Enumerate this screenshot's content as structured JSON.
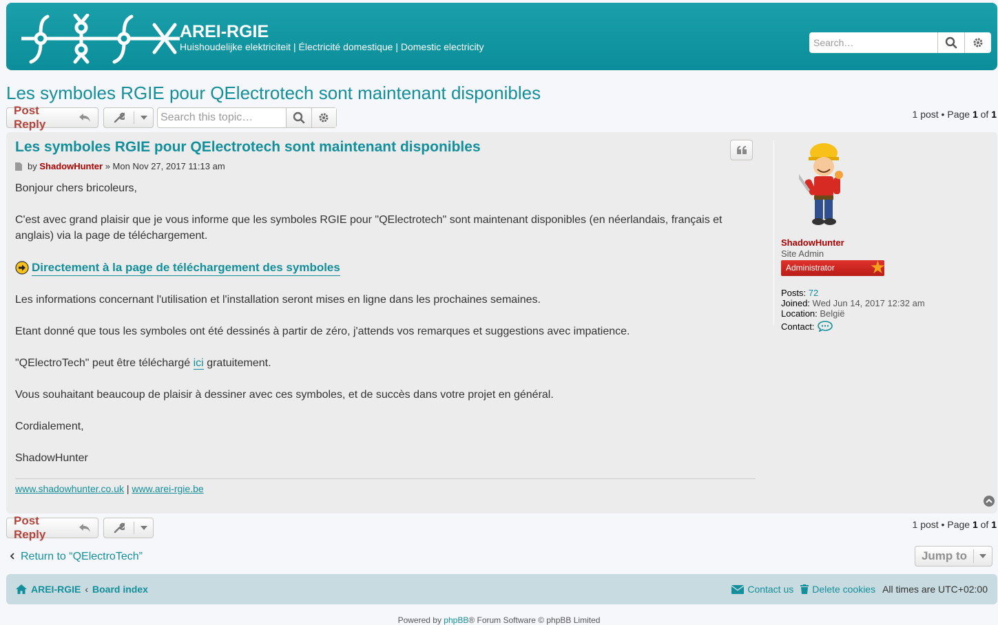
{
  "header": {
    "site_title": "AREI-RGIE",
    "site_desc": "Huishoudelijke elektriciteit | Électricité domestique | Domestic electricity",
    "search_placeholder": "Search…",
    "logo_icon": "circuit-logo-icon"
  },
  "topic": {
    "title": "Les symboles RGIE pour QElectrotech sont maintenant disponibles",
    "post_reply": "Post Reply",
    "search_placeholder": "Search this topic…",
    "pagination_prefix": "1 post • Page",
    "page_current": "1",
    "page_of": "of",
    "page_total": "1"
  },
  "post": {
    "title": "Les symboles RGIE pour QElectrotech sont maintenant disponibles",
    "by": "by",
    "author": "ShadowHunter",
    "date": "» Mon Nov 27, 2017 11:13 am",
    "p1": "Bonjour chers bricoleurs,",
    "p2": "C'est avec grand plaisir que je vous informe que les symboles RGIE pour \"QElectrotech\" sont maintenant disponibles (en néerlandais, français et anglais) via la page de téléchargement.",
    "download_link": "Directement à la page de téléchargement des symboles",
    "p3": "Les informations concernant l'utilisation et l'installation seront mises en ligne dans les prochaines semaines.",
    "p4": "Etant donné que tous les symboles ont été dessinés à partir de zéro, j'attends vos remarques et suggestions avec impatience.",
    "p5_before": "\"QElectroTech\" peut être téléchargé",
    "p5_link": "ici",
    "p5_after": "gratuitement.",
    "p6": "Vous souhaitant beaucoup de plaisir à dessiner avec ces symboles, et de succès dans votre projet en général.",
    "p7": "Cordialement,",
    "p8": "ShadowHunter",
    "sig_link1": "www.shadowhunter.co.uk",
    "sig_sep": "|",
    "sig_link2": "www.arei-rgie.be"
  },
  "profile": {
    "username": "ShadowHunter",
    "rank": "Site Admin",
    "badge": "Administrator",
    "posts_label": "Posts:",
    "posts_value": "72",
    "joined_label": "Joined:",
    "joined_value": "Wed Jun 14, 2017 12:32 am",
    "location_label": "Location:",
    "location_value": "België",
    "contact_label": "Contact:"
  },
  "bottom": {
    "return_link": "Return to “QElectroTech”",
    "jump_to": "Jump to"
  },
  "footer": {
    "home": "AREI-RGIE",
    "sep": "‹",
    "board_index": "Board index",
    "contact": "Contact us",
    "delete_cookies": "Delete cookies",
    "timezone": "All times are UTC+02:00",
    "powered_prefix": "Powered by",
    "powered_link": "phpBB",
    "powered_suffix": "® Forum Software © phpBB Limited"
  },
  "colors": {
    "brand": "#0e97a3",
    "link": "#128f9b",
    "username": "#aa0000",
    "reply": "#b3443b"
  }
}
